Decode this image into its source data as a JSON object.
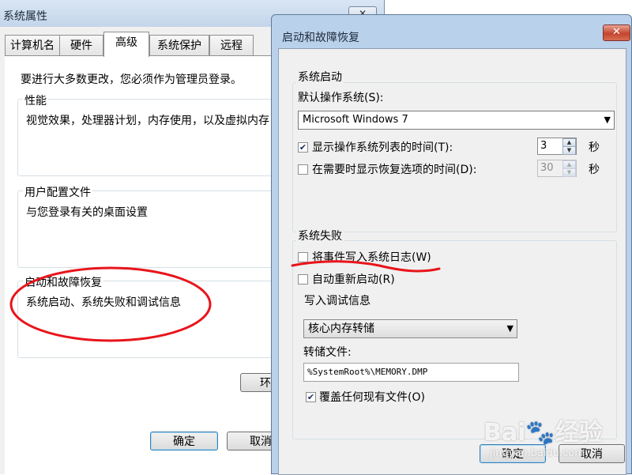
{
  "back_window": {
    "title": "系统属性",
    "close_glyph": "✕",
    "tabs": [
      "计算机名",
      "硬件",
      "高级",
      "系统保护",
      "远程"
    ],
    "admin_note": "要进行大多数更改，您必须作为管理员登录。",
    "performance": {
      "label": "性能",
      "desc": "视觉效果，处理器计划，内存使用，以及虚拟内存"
    },
    "user_profiles": {
      "label": "用户配置文件",
      "desc": "与您登录有关的桌面设置"
    },
    "startup_recovery": {
      "label": "启动和故障恢复",
      "desc": "系统启动、系统失败和调试信息"
    },
    "env_button_partial": "环",
    "ok": "确定",
    "cancel": "取消"
  },
  "dialog": {
    "title": "启动和故障恢复",
    "close_glyph": "✕",
    "system_startup": {
      "label": "系统启动",
      "default_os_label": "默认操作系统(S):",
      "default_os_value": "Microsoft Windows 7",
      "show_list": {
        "label": "显示操作系统列表的时间(T):",
        "checked": true,
        "value": "3",
        "unit": "秒"
      },
      "show_recovery": {
        "label": "在需要时显示恢复选项的时间(D):",
        "checked": false,
        "value": "30",
        "unit": "秒"
      }
    },
    "system_failure": {
      "label": "系统失败",
      "write_event": {
        "label": "将事件写入系统日志(W)",
        "checked": false
      },
      "auto_restart": {
        "label": "自动重新启动(R)",
        "checked": false
      },
      "debug_info": {
        "label": "写入调试信息",
        "selected": "核心内存转储",
        "dump_file_label": "转储文件:",
        "dump_file_value": "%SystemRoot%\\MEMORY.DMP",
        "overwrite": {
          "label": "覆盖任何现有文件(O)",
          "checked": true
        }
      }
    },
    "ok": "确定",
    "cancel": "取消"
  },
  "watermark": {
    "brand": "Bai",
    "brand_tail": "经验",
    "url": "jingyan.baidu.com"
  },
  "colors": {
    "annotation_red": "#e8141a",
    "title_bar": "#b9d1ea"
  }
}
